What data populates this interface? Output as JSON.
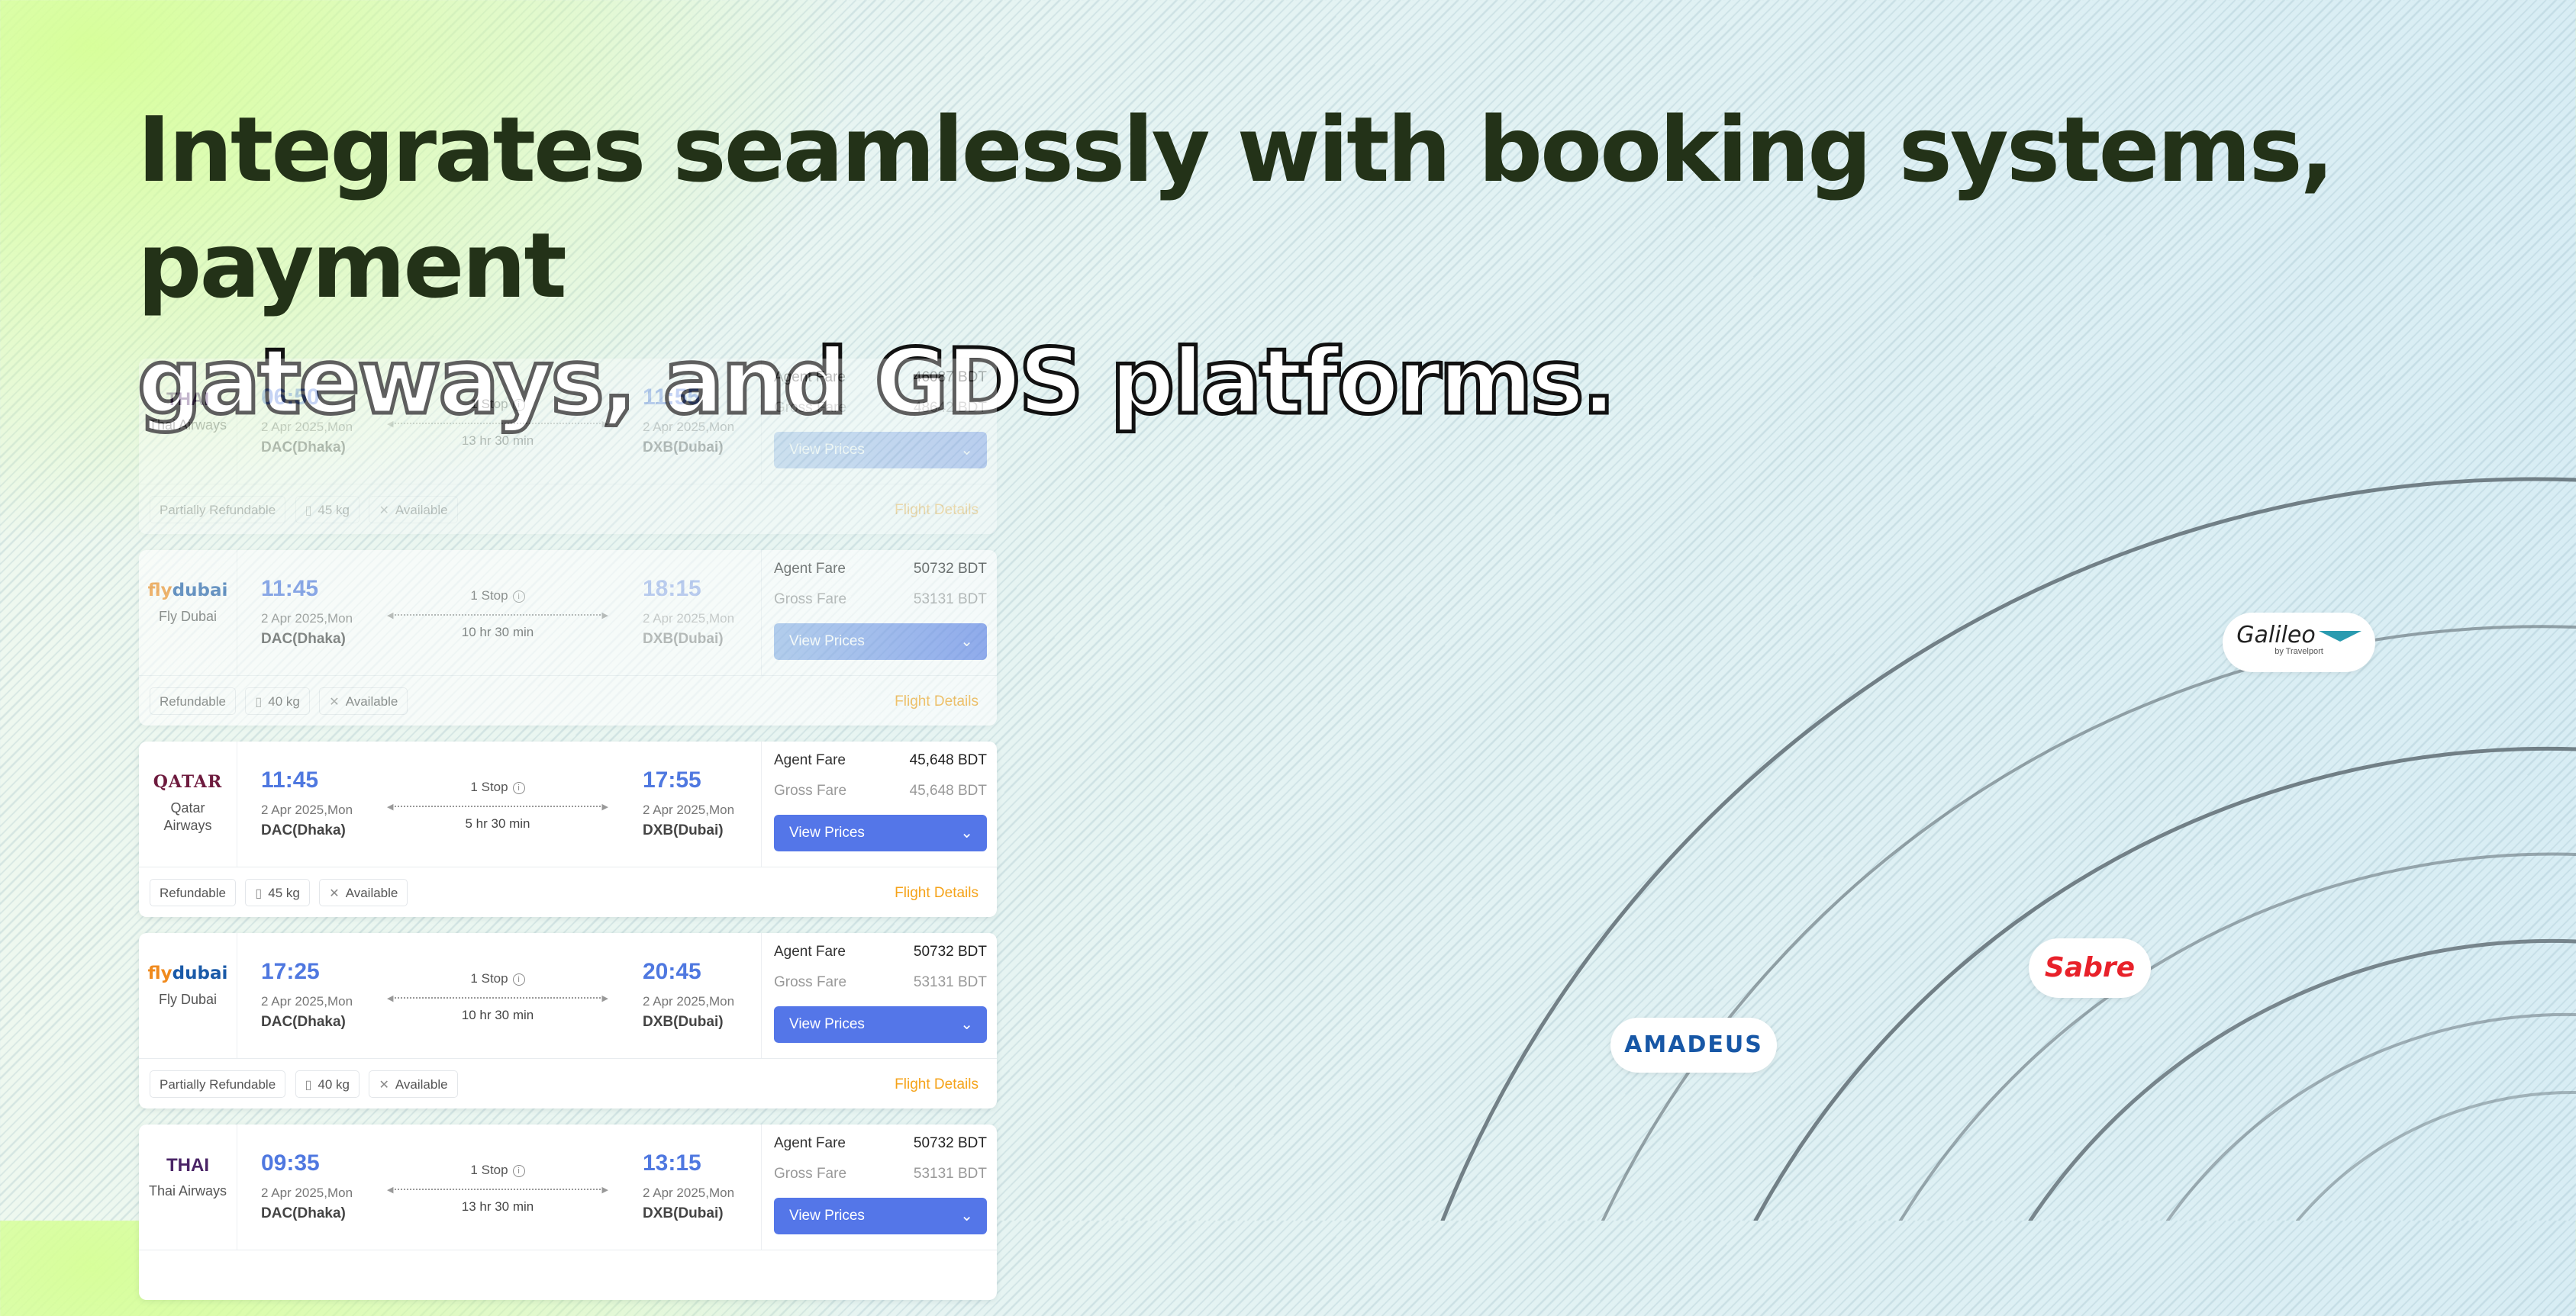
{
  "headline": {
    "line1": "Integrates seamlessly with booking systems, payment",
    "line2": "gateways, and GDS platforms."
  },
  "flight_details_label": "Flight Details",
  "view_prices_label": "View Prices",
  "agent_fare_label": "Agent Fare",
  "gross_fare_label": "Gross Fare",
  "flights": [
    {
      "logo": "THAI",
      "airline": "Thai Airways",
      "dep_time": "06:50",
      "dep_date": "2 Apr 2025,Mon",
      "dep_city": "DAC(Dhaka)",
      "stops": "1 Stop",
      "duration": "13 hr 30 min",
      "arr_time": "11:55",
      "arr_date": "2 Apr 2025,Mon",
      "arr_city": "DXB(Dubai)",
      "agent_fare": "46087 BDT",
      "gross_fare": "48642 BDT",
      "refund": "Partially Refundable",
      "baggage": "45 kg",
      "meal": "Available"
    },
    {
      "logo": "flydubai",
      "airline": "Fly Dubai",
      "dep_time": "11:45",
      "dep_date": "2 Apr 2025,Mon",
      "dep_city": "DAC(Dhaka)",
      "stops": "1 Stop",
      "duration": "10 hr 30 min",
      "arr_time": "18:15",
      "arr_date": "2 Apr 2025,Mon",
      "arr_city": "DXB(Dubai)",
      "agent_fare": "50732 BDT",
      "gross_fare": "53131 BDT",
      "refund": "Refundable",
      "baggage": "40 kg",
      "meal": "Available"
    },
    {
      "logo": "QATAR",
      "airline": "Qatar Airways",
      "dep_time": "11:45",
      "dep_date": "2 Apr 2025,Mon",
      "dep_city": "DAC(Dhaka)",
      "stops": "1 Stop",
      "duration": "5 hr 30 min",
      "arr_time": "17:55",
      "arr_date": "2 Apr 2025,Mon",
      "arr_city": "DXB(Dubai)",
      "agent_fare": "45,648 BDT",
      "gross_fare": "45,648 BDT",
      "refund": "Refundable",
      "baggage": "45 kg",
      "meal": "Available"
    },
    {
      "logo": "flydubai",
      "airline": "Fly Dubai",
      "dep_time": "17:25",
      "dep_date": "2 Apr 2025,Mon",
      "dep_city": "DAC(Dhaka)",
      "stops": "1 Stop",
      "duration": "10 hr 30 min",
      "arr_time": "20:45",
      "arr_date": "2 Apr 2025,Mon",
      "arr_city": "DXB(Dubai)",
      "agent_fare": "50732 BDT",
      "gross_fare": "53131 BDT",
      "refund": "Partially Refundable",
      "baggage": "40 kg",
      "meal": "Available"
    },
    {
      "logo": "THAI",
      "airline": "Thai Airways",
      "dep_time": "09:35",
      "dep_date": "2 Apr 2025,Mon",
      "dep_city": "DAC(Dhaka)",
      "stops": "1 Stop",
      "duration": "13 hr 30 min",
      "arr_time": "13:15",
      "arr_date": "2 Apr 2025,Mon",
      "arr_city": "DXB(Dubai)",
      "agent_fare": "50732 BDT",
      "gross_fare": "53131 BDT",
      "refund": "",
      "baggage": "",
      "meal": ""
    }
  ],
  "gds_partners": {
    "galileo": {
      "name": "Galileo",
      "tagline": "by Travelport"
    },
    "sabre": {
      "name": "Sabre"
    },
    "amadeus": {
      "name": "AMADEUS"
    }
  },
  "colors": {
    "accent": "#5476e8",
    "time_blue": "#4f78e0",
    "link_orange": "#f5a31a",
    "headline": "#233218",
    "sabre_red": "#e8212a",
    "amadeus_blue": "#1757a6"
  },
  "icons": [
    "info-icon",
    "baggage-icon",
    "meal-icon",
    "chevron-down-icon",
    "plane-left-icon",
    "plane-right-icon"
  ]
}
